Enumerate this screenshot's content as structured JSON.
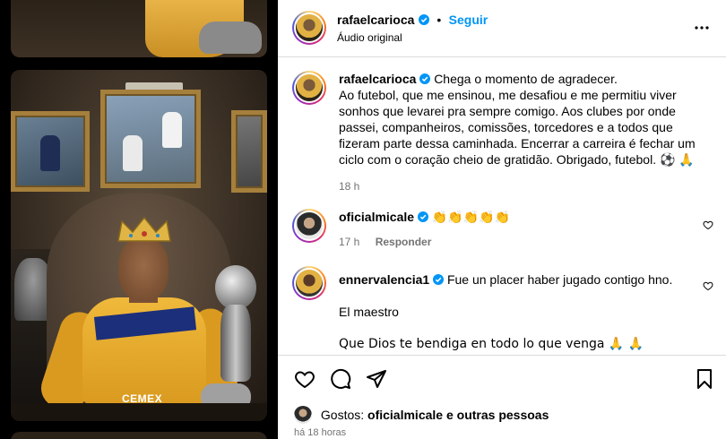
{
  "post": {
    "author": "rafaelcarioca",
    "follow_label": "Seguir",
    "dot": "•",
    "audio": "Áudio original",
    "caption_first": "Chega o momento de agradecer.",
    "caption_rest": "Ao futebol, que me ensinou, me desafiou e me permitiu viver sonhos que levarei pra sempre comigo. Aos clubes por onde passei, companheiros, comissões, torcedores e a todos que fizeram parte dessa caminhada. Encerrar a carreira é fechar um ciclo com o coração cheio de gratidão. Obrigado, futebol. ⚽ 🙏",
    "caption_time": "18 h"
  },
  "media": {
    "sponsor_text": "CEMEX"
  },
  "comments": [
    {
      "user": "oficialmicale",
      "text": "👏👏👏👏👏",
      "time": "17 h",
      "reply_label": "Responder"
    },
    {
      "user": "ennervalencia1",
      "line1": "Fue un placer haber jugado contigo hno.",
      "line2": "El maestro",
      "line3": "Que Dios te bendiga en todo lo que venga 🙏 🙏"
    }
  ],
  "footer": {
    "likes_prefix": "Gostos:",
    "likes_user": "oficialmicale",
    "likes_suffix": "e outras pessoas",
    "time": "há 18 horas"
  },
  "icons": {
    "verified": "verified-badge-icon",
    "more": "more-options-icon",
    "like": "heart-icon",
    "comment": "comment-icon",
    "share": "send-icon",
    "save": "bookmark-icon"
  },
  "colors": {
    "accent": "#0095f6",
    "muted": "#737373",
    "divider": "#dbdbdb",
    "verified": "#0095f6"
  }
}
